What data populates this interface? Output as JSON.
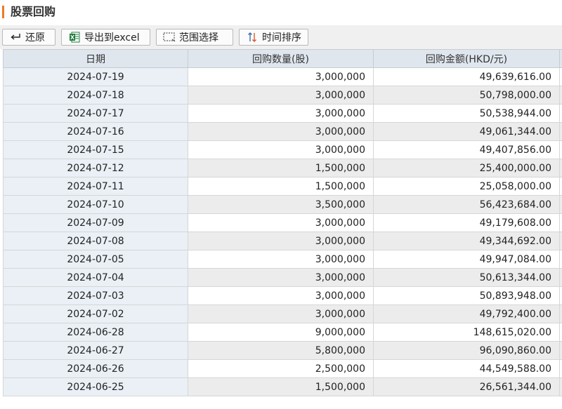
{
  "page": {
    "title": "股票回购",
    "accent_color": "#f07a22"
  },
  "toolbar": {
    "restore_label": "还原",
    "export_label": "导出到excel",
    "range_label": "范围选择",
    "sort_label": "时间排序",
    "icons": {
      "restore": "return-arrow-icon",
      "export": "excel-icon",
      "range": "dashed-selection-icon",
      "sort": "sort-arrows-icon"
    }
  },
  "table": {
    "columns": [
      "日期",
      "回购数量(股)",
      "回购金额(HKD/元)"
    ],
    "rows": [
      [
        "2024-07-19",
        "3,000,000",
        "49,639,616.00"
      ],
      [
        "2024-07-18",
        "3,000,000",
        "50,798,000.00"
      ],
      [
        "2024-07-17",
        "3,000,000",
        "50,538,944.00"
      ],
      [
        "2024-07-16",
        "3,000,000",
        "49,061,344.00"
      ],
      [
        "2024-07-15",
        "3,000,000",
        "49,407,856.00"
      ],
      [
        "2024-07-12",
        "1,500,000",
        "25,400,000.00"
      ],
      [
        "2024-07-11",
        "1,500,000",
        "25,058,000.00"
      ],
      [
        "2024-07-10",
        "3,500,000",
        "56,423,684.00"
      ],
      [
        "2024-07-09",
        "3,000,000",
        "49,179,608.00"
      ],
      [
        "2024-07-08",
        "3,000,000",
        "49,344,692.00"
      ],
      [
        "2024-07-05",
        "3,000,000",
        "49,947,084.00"
      ],
      [
        "2024-07-04",
        "3,000,000",
        "50,613,344.00"
      ],
      [
        "2024-07-03",
        "3,000,000",
        "50,893,948.00"
      ],
      [
        "2024-07-02",
        "3,000,000",
        "49,792,400.00"
      ],
      [
        "2024-06-28",
        "9,000,000",
        "148,615,020.00"
      ],
      [
        "2024-06-27",
        "5,800,000",
        "96,090,860.00"
      ],
      [
        "2024-06-26",
        "2,500,000",
        "44,549,588.00"
      ],
      [
        "2024-06-25",
        "1,500,000",
        "26,561,344.00"
      ]
    ]
  }
}
